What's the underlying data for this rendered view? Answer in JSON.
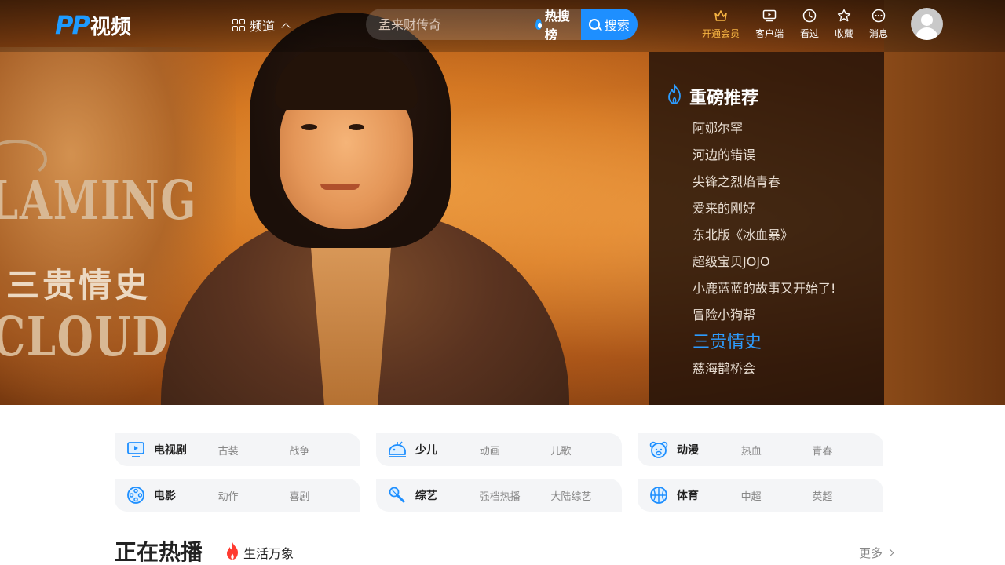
{
  "header": {
    "logo_mark": "PP",
    "logo_text": "视频",
    "channel_label": "频道",
    "search_placeholder": "孟来财传奇",
    "hotlist_label": "热搜榜",
    "search_button_label": "搜索",
    "nav": [
      {
        "label": "开通会员",
        "icon": "crown-icon"
      },
      {
        "label": "客户端",
        "icon": "tv-play-icon"
      },
      {
        "label": "看过",
        "icon": "clock-icon"
      },
      {
        "label": "收藏",
        "icon": "star-icon"
      },
      {
        "label": "消息",
        "icon": "message-icon"
      }
    ]
  },
  "hero": {
    "title_en_1": "LAMING",
    "title_cn": "三贵情史",
    "title_en_2": "CLOUD"
  },
  "recommend": {
    "title": "重磅推荐",
    "items": [
      "阿娜尔罕",
      "河边的错误",
      "尖锋之烈焰青春",
      "爱来的刚好",
      "东北版《冰血暴》",
      "超级宝贝JOJO",
      "小鹿蓝蓝的故事又开始了!",
      "冒险小狗帮",
      "三贵情史",
      "慈海鹊桥会"
    ],
    "active_index": 8
  },
  "categories": [
    {
      "name": "电视剧",
      "icon": "tv-icon",
      "subs": [
        "古装",
        "战争"
      ]
    },
    {
      "name": "少儿",
      "icon": "kids-icon",
      "subs": [
        "动画",
        "儿歌"
      ]
    },
    {
      "name": "动漫",
      "icon": "anime-icon",
      "subs": [
        "热血",
        "青春"
      ]
    },
    {
      "name": "电影",
      "icon": "film-reel-icon",
      "subs": [
        "动作",
        "喜剧"
      ]
    },
    {
      "name": "综艺",
      "icon": "microphone-icon",
      "subs": [
        "强档热播",
        "大陆综艺"
      ]
    },
    {
      "name": "体育",
      "icon": "basketball-icon",
      "subs": [
        "中超",
        "英超"
      ]
    }
  ],
  "section": {
    "title": "正在热播",
    "tag": "生活万象",
    "more": "更多"
  },
  "colors": {
    "accent_blue": "#1e8fff",
    "vip_gold": "#f5b342",
    "active_item": "#2d9cff",
    "hot_red": "#ff3b30"
  }
}
